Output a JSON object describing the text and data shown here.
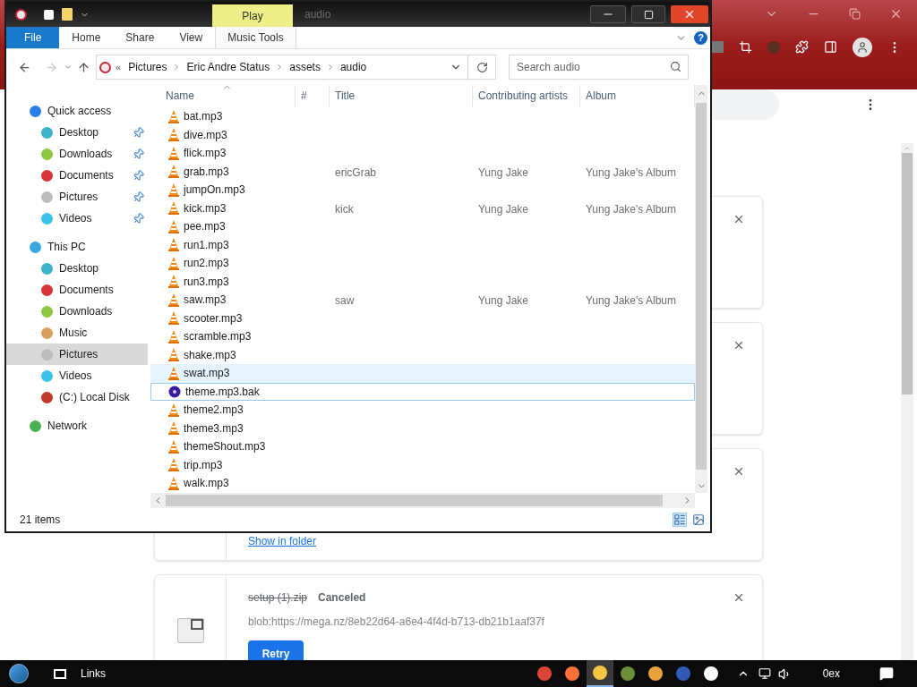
{
  "browser": {
    "downloads": [
      {
        "kind": "hidden"
      },
      {
        "kind": "hidden"
      },
      {
        "kind": "link",
        "link": "Show in folder"
      },
      {
        "kind": "full",
        "name": "setup (1).zip",
        "canceled": true,
        "status": "Canceled",
        "url": "blob:https://mega.nz/8eb22d64-a6e4-4f4d-b713-db21b1aaf37f",
        "button": "Retry"
      }
    ]
  },
  "explorer": {
    "title": "audio",
    "context_label": "Play",
    "help": "?",
    "tabs": [
      {
        "label": "File",
        "kind": "file"
      },
      {
        "label": "Home",
        "kind": "tab"
      },
      {
        "label": "Share",
        "kind": "tab"
      },
      {
        "label": "View",
        "kind": "tab"
      },
      {
        "label": "Music Tools",
        "kind": "context"
      }
    ],
    "address": {
      "overflow": "«",
      "path": [
        "Pictures",
        "Eric Andre Status",
        "assets",
        "audio"
      ]
    },
    "search": {
      "placeholder": "Search audio"
    },
    "nav": [
      {
        "label": "Quick access",
        "color": "#2a7ee6",
        "selected": false,
        "children": [
          {
            "label": "Desktop",
            "color": "#3bb3c9",
            "pinned": true,
            "selected": false
          },
          {
            "label": "Downloads",
            "color": "#8dc63f",
            "pinned": true,
            "selected": false
          },
          {
            "label": "Documents",
            "color": "#d9343a",
            "pinned": true,
            "selected": false
          },
          {
            "label": "Pictures",
            "color": "#bdbdbd",
            "pinned": true,
            "selected": false
          },
          {
            "label": "Videos",
            "color": "#3ac3e6",
            "pinned": true,
            "selected": false
          }
        ]
      },
      {
        "label": "This PC",
        "color": "#3aa7e0",
        "selected": false,
        "children": [
          {
            "label": "Desktop",
            "color": "#3bb3c9",
            "pinned": false,
            "selected": false
          },
          {
            "label": "Documents",
            "color": "#d9343a",
            "pinned": false,
            "selected": false
          },
          {
            "label": "Downloads",
            "color": "#8dc63f",
            "pinned": false,
            "selected": false
          },
          {
            "label": "Music",
            "color": "#d9a05b",
            "pinned": false,
            "selected": false
          },
          {
            "label": "Pictures",
            "color": "#bdbdbd",
            "pinned": false,
            "selected": true
          },
          {
            "label": "Videos",
            "color": "#3ac3e6",
            "pinned": false,
            "selected": false
          },
          {
            "label": "(C:) Local Disk",
            "color": "#c0392b",
            "pinned": false,
            "selected": false
          }
        ]
      },
      {
        "label": "Network",
        "color": "#4caf50",
        "selected": false
      }
    ],
    "columns": [
      "Name",
      "#",
      "Title",
      "Contributing artists",
      "Album"
    ],
    "rows": [
      {
        "name": "bat.mp3",
        "kind": "audio",
        "hovered": false,
        "focused": false
      },
      {
        "name": "dive.mp3",
        "kind": "audio",
        "hovered": false,
        "focused": false
      },
      {
        "name": "flick.mp3",
        "kind": "audio",
        "hovered": false,
        "focused": false
      },
      {
        "name": "grab.mp3",
        "kind": "audio",
        "title": "ericGrab",
        "artist": "Yung Jake",
        "album": "Yung Jake's Album",
        "hovered": false,
        "focused": false
      },
      {
        "name": "jumpOn.mp3",
        "kind": "audio",
        "hovered": false,
        "focused": false
      },
      {
        "name": "kick.mp3",
        "kind": "audio",
        "title": "kick",
        "artist": "Yung Jake",
        "album": "Yung Jake's Album",
        "hovered": false,
        "focused": false
      },
      {
        "name": "pee.mp3",
        "kind": "audio",
        "hovered": false,
        "focused": false
      },
      {
        "name": "run1.mp3",
        "kind": "audio",
        "hovered": false,
        "focused": false
      },
      {
        "name": "run2.mp3",
        "kind": "audio",
        "hovered": false,
        "focused": false
      },
      {
        "name": "run3.mp3",
        "kind": "audio",
        "hovered": false,
        "focused": false
      },
      {
        "name": "saw.mp3",
        "kind": "audio",
        "title": "saw",
        "artist": "Yung Jake",
        "album": "Yung Jake's Album",
        "hovered": false,
        "focused": false
      },
      {
        "name": "scooter.mp3",
        "kind": "audio",
        "hovered": false,
        "focused": false
      },
      {
        "name": "scramble.mp3",
        "kind": "audio",
        "hovered": false,
        "focused": false
      },
      {
        "name": "shake.mp3",
        "kind": "audio",
        "hovered": false,
        "focused": false
      },
      {
        "name": "swat.mp3",
        "kind": "audio",
        "hovered": true,
        "focused": false
      },
      {
        "name": "theme.mp3.bak",
        "kind": "backup",
        "hovered": false,
        "focused": true
      },
      {
        "name": "theme2.mp3",
        "kind": "audio",
        "hovered": false,
        "focused": false
      },
      {
        "name": "theme3.mp3",
        "kind": "audio",
        "hovered": false,
        "focused": false
      },
      {
        "name": "themeShout.mp3",
        "kind": "audio",
        "hovered": false,
        "focused": false
      },
      {
        "name": "trip.mp3",
        "kind": "audio",
        "hovered": false,
        "focused": false
      },
      {
        "name": "walk.mp3",
        "kind": "audio",
        "hovered": false,
        "focused": false
      }
    ],
    "status": "21 items"
  },
  "taskbar": {
    "toolbar": "Links",
    "tray_text": "0ex"
  }
}
